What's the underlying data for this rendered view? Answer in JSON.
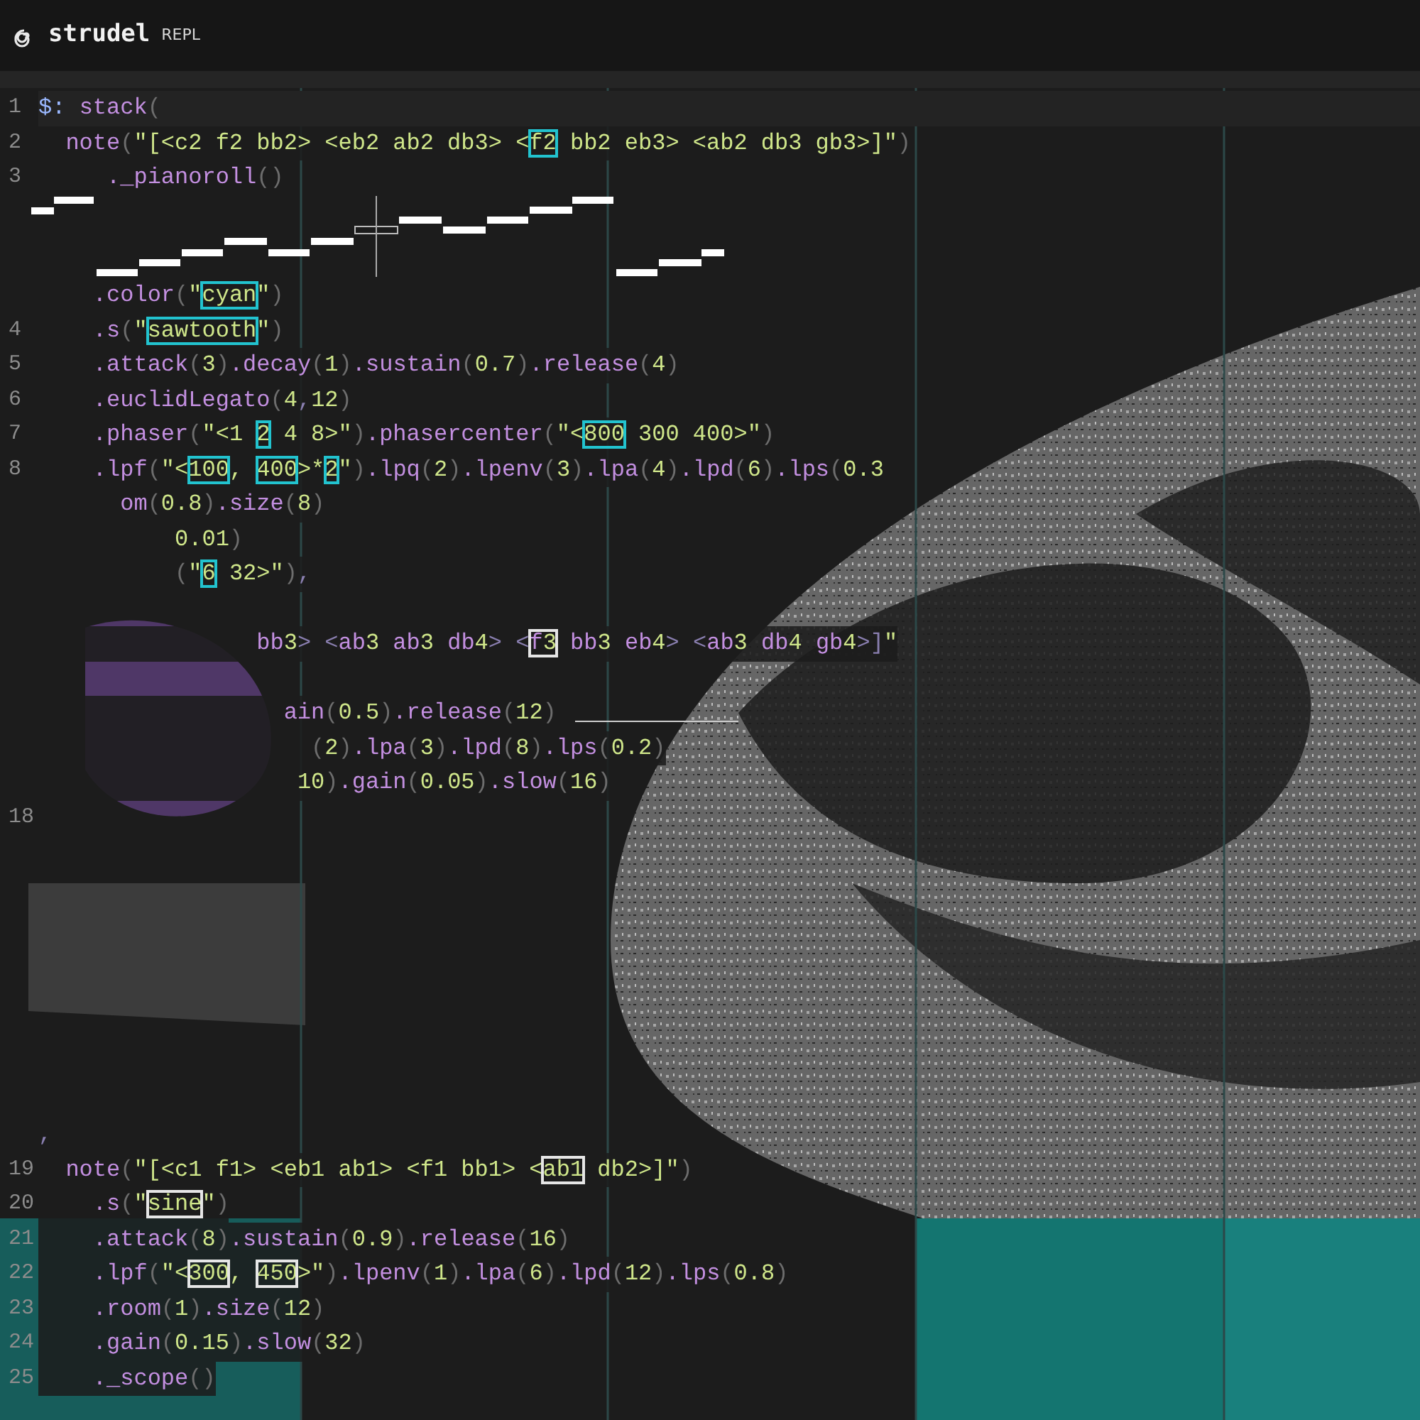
{
  "app": {
    "title": "strudel",
    "subtitle": "REPL"
  },
  "editor": {
    "lines": [
      {
        "kind": "code",
        "number": "1",
        "active": true,
        "segments": [
          {
            "text": "$: stack("
          }
        ]
      },
      {
        "kind": "code",
        "number": "2",
        "active": false,
        "segments": [
          {
            "text": "  note(\"[<c2 f2 bb2> <eb2 ab2 db3> <"
          },
          {
            "text": "f2",
            "color": "#22c3cf"
          },
          {
            "text": " bb2 eb3> <ab2 db3 gb3>]\")"
          }
        ]
      },
      {
        "kind": "code",
        "number": "3",
        "active": false,
        "segments": [
          {
            "text": "     ._pianoroll()"
          }
        ]
      },
      {
        "kind": "pianoroll"
      },
      {
        "kind": "code",
        "active": false,
        "segments": [
          {
            "text": "    .color(\""
          },
          {
            "text": "cyan",
            "color": "#22c3cf"
          },
          {
            "text": "\")"
          }
        ]
      },
      {
        "kind": "code",
        "number": "4",
        "active": false,
        "segments": [
          {
            "text": "    .s(\""
          },
          {
            "text": "sawtooth",
            "color": "#22c3cf"
          },
          {
            "text": "\")"
          }
        ]
      },
      {
        "kind": "code",
        "number": "5",
        "active": false,
        "segments": [
          {
            "text": "    .attack(3).decay(1).sustain(0.7).release(4)"
          }
        ]
      },
      {
        "kind": "code",
        "number": "6",
        "active": false,
        "segments": [
          {
            "text": "    .euclidLegato(4,12)"
          }
        ]
      },
      {
        "kind": "code",
        "number": "7",
        "active": false,
        "segments": [
          {
            "text": "    .phaser(\"<1 "
          },
          {
            "text": "2",
            "color": "#22c3cf"
          },
          {
            "text": " 4 8>\").phasercenter(\"<"
          },
          {
            "text": "800",
            "color": "#22c3cf"
          },
          {
            "text": " 300 400>\")"
          }
        ]
      },
      {
        "kind": "code",
        "number": "8",
        "active": false,
        "segments": [
          {
            "text": "    .lpf(\"<"
          },
          {
            "text": "100",
            "color": "#22c3cf"
          },
          {
            "text": ", "
          },
          {
            "text": "400",
            "color": "#22c3cf"
          },
          {
            "text": ">*"
          },
          {
            "text": "2",
            "color": "#22c3cf"
          },
          {
            "text": "\").lpq(2).lpenv(3).lpa(4).lpd(6).lps(0.3"
          }
        ]
      },
      {
        "kind": "code",
        "active": false,
        "segments": [
          {
            "text": "      om(0.8).size(8)"
          }
        ]
      },
      {
        "kind": "code",
        "active": false,
        "segments": [
          {
            "text": "          0.01)"
          }
        ]
      },
      {
        "kind": "code",
        "active": false,
        "segments": [
          {
            "text": "          (\""
          },
          {
            "text": "6",
            "color": "#22c3cf"
          },
          {
            "text": " 32>\"),"
          }
        ]
      },
      {
        "kind": "gap"
      },
      {
        "kind": "code",
        "active": false,
        "segments": [
          {
            "text": "                bb3> <ab3 ab3 db4> <"
          },
          {
            "text": "f3",
            "color": "#e6e6e6"
          },
          {
            "text": " bb3 eb4> <ab3 db4 gb4>]\""
          }
        ]
      },
      {
        "kind": "gap"
      },
      {
        "kind": "code",
        "active": false,
        "segments": [
          {
            "text": "                  ain(0.5).release(12)"
          }
        ]
      },
      {
        "kind": "code",
        "active": false,
        "segments": [
          {
            "text": "                    (2).lpa(3).lpd(8).lps(0.2)"
          }
        ]
      },
      {
        "kind": "code",
        "active": false,
        "segments": [
          {
            "text": "                   10).gain(0.05).slow(16)"
          }
        ]
      },
      {
        "kind": "code",
        "number": "18",
        "active": false
      },
      {
        "kind": "visual"
      },
      {
        "kind": "code",
        "active": false,
        "segments": [
          {
            "text": ","
          }
        ]
      },
      {
        "kind": "code",
        "number": "19",
        "active": false,
        "segments": [
          {
            "text": "  note(\"[<c1 f1> <eb1 ab1> <f1 bb1> <"
          },
          {
            "text": "ab1",
            "color": "#e6e6e6"
          },
          {
            "text": " db2>]\")"
          }
        ]
      },
      {
        "kind": "code",
        "number": "20",
        "active": false,
        "segments": [
          {
            "text": "    .s(\""
          },
          {
            "text": "sine",
            "color": "#e6e6e6"
          },
          {
            "text": "\")"
          }
        ]
      },
      {
        "kind": "code",
        "number": "21",
        "active": false,
        "segments": [
          {
            "text": "    .attack(8).sustain(0.9).release(16)"
          }
        ]
      },
      {
        "kind": "code",
        "number": "22",
        "active": false,
        "segments": [
          {
            "text": "    .lpf(\"<"
          },
          {
            "text": "300",
            "color": "#e6e6e6"
          },
          {
            "text": ", "
          },
          {
            "text": "450",
            "color": "#e6e6e6"
          },
          {
            "text": ">\").lpenv(1).lpa(6).lpd(12).lps(0.8)"
          }
        ]
      },
      {
        "kind": "code",
        "number": "23",
        "active": false,
        "segments": [
          {
            "text": "    .room(1).size(12)"
          }
        ]
      },
      {
        "kind": "code",
        "number": "24",
        "active": false,
        "segments": [
          {
            "text": "    .gain(0.15).slow(32)"
          }
        ]
      },
      {
        "kind": "code",
        "number": "25",
        "active": false,
        "segments": [
          {
            "text": "    ._scope()"
          }
        ]
      }
    ]
  }
}
